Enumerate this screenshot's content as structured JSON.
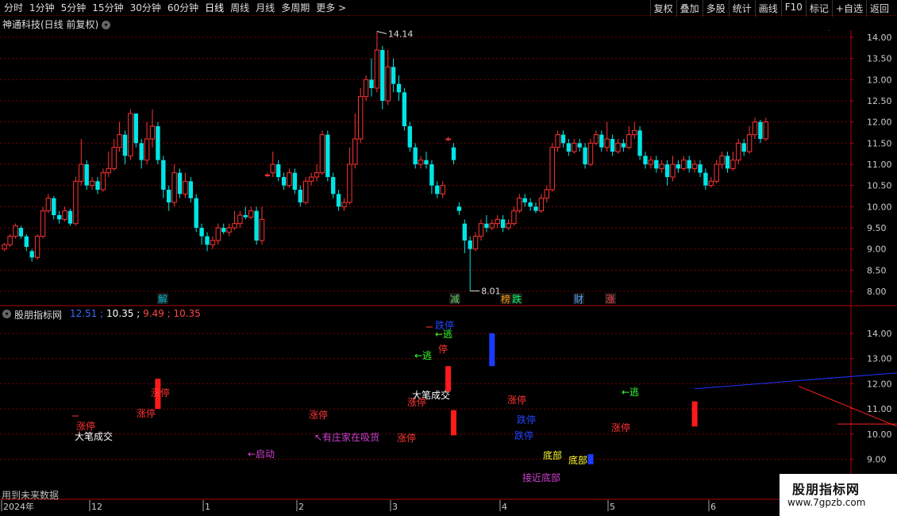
{
  "toolbar": {
    "periods": [
      "分时",
      "1分钟",
      "5分钟",
      "15分钟",
      "30分钟",
      "60分钟",
      "日线",
      "周线",
      "月线",
      "多周期",
      "更多 >"
    ],
    "active_period": "日线",
    "right_buttons": [
      "复权",
      "叠加",
      "多股",
      "统计",
      "画线",
      "F10",
      "标记",
      "+自选",
      "返回"
    ]
  },
  "main_chart": {
    "title": "神通科技(日线 前复权)",
    "high_label": "14.14",
    "low_label": "8.01",
    "y_ticks": [
      "14.00",
      "13.50",
      "13.00",
      "12.50",
      "12.00",
      "11.50",
      "11.00",
      "10.50",
      "10.00",
      "9.50",
      "9.00",
      "8.50",
      "8.00"
    ],
    "events": [
      {
        "text": "解",
        "color": "#00bcd4"
      },
      {
        "text": "减",
        "color": "#6ad06a"
      },
      {
        "text": "榜",
        "color": "#ff9900"
      },
      {
        "text": "跌",
        "color": "#00ff66"
      },
      {
        "text": "财",
        "color": "#4fa3ff"
      },
      {
        "text": "涨",
        "color": "#ff4444"
      }
    ]
  },
  "indicator": {
    "name": "股朋指标网",
    "values": [
      "12.51",
      "10.35",
      "9.49",
      "10.35"
    ],
    "value_colors": [
      "#3b6bff",
      "#ffffff",
      "#ff4444",
      "#ff4444"
    ],
    "y_ticks": [
      "14.00",
      "13.00",
      "12.00",
      "11.00",
      "10.00",
      "9.00"
    ],
    "labels": {
      "zt1": "涨停",
      "dbcj1": "大笔成交",
      "zt2": "涨停",
      "zt3": "涨停",
      "qd": "←启动",
      "zt4": "涨停",
      "zj": "↖有庄家在吸货",
      "zt5": "涨停",
      "dbcj2": "大笔成交",
      "zt6": "涨停",
      "dt1": "跌停",
      "tao1": "←逃",
      "tao2": "←逃",
      "ting": "停",
      "zt7": "涨停",
      "dt2": "跌停",
      "dt3": "跌停",
      "db1": "底部",
      "db2": "底部",
      "jjdb": "接近底部",
      "tao3": "←逃",
      "zt8": "涨停"
    }
  },
  "future_note": "用到未来数据",
  "xaxis": {
    "labels": [
      "2024年",
      "12",
      "1",
      "2",
      "3",
      "4",
      "5",
      "6"
    ]
  },
  "watermark": {
    "title": "股朋指标网",
    "url": "www.7gpzb.com"
  },
  "colors": {
    "up": "#ff3333",
    "down": "#00e5e5",
    "grid": "#7a0000",
    "axis": "#b00000"
  },
  "chart_data": {
    "type": "candlestick",
    "candles": [
      [
        9.0,
        9.1,
        8.95,
        9.15
      ],
      [
        9.1,
        9.3,
        9.05,
        9.35
      ],
      [
        9.3,
        9.55,
        9.25,
        9.6
      ],
      [
        9.5,
        9.3,
        9.25,
        9.55
      ],
      [
        9.3,
        9.05,
        8.95,
        9.35
      ],
      [
        8.95,
        8.8,
        8.7,
        9.0
      ],
      [
        8.8,
        9.3,
        8.75,
        9.35
      ],
      [
        9.3,
        9.9,
        9.25,
        10.0
      ],
      [
        9.9,
        10.2,
        9.85,
        10.3
      ],
      [
        10.2,
        9.8,
        9.7,
        10.25
      ],
      [
        9.8,
        9.7,
        9.6,
        9.9
      ],
      [
        9.7,
        9.9,
        9.65,
        10.0
      ],
      [
        9.9,
        9.6,
        9.55,
        9.95
      ],
      [
        9.6,
        10.6,
        9.55,
        10.7
      ],
      [
        10.6,
        11.0,
        10.5,
        11.6
      ],
      [
        11.0,
        10.5,
        10.4,
        11.1
      ],
      [
        10.5,
        10.6,
        10.4,
        10.7
      ],
      [
        10.6,
        10.4,
        10.3,
        10.7
      ],
      [
        10.4,
        10.8,
        10.35,
        10.9
      ],
      [
        10.8,
        10.9,
        10.7,
        11.3
      ],
      [
        10.9,
        11.4,
        10.85,
        11.6
      ],
      [
        11.4,
        11.7,
        11.3,
        12.0
      ],
      [
        11.7,
        11.2,
        11.0,
        11.8
      ],
      [
        11.2,
        12.2,
        11.1,
        12.3
      ],
      [
        12.2,
        11.5,
        11.4,
        12.2
      ],
      [
        11.5,
        11.1,
        10.9,
        11.6
      ],
      [
        11.1,
        11.6,
        11.0,
        12.0
      ],
      [
        11.6,
        11.9,
        11.4,
        12.3
      ],
      [
        11.9,
        11.1,
        11.0,
        12.0
      ],
      [
        11.1,
        10.4,
        10.2,
        11.2
      ],
      [
        10.4,
        10.1,
        9.9,
        10.5
      ],
      [
        10.1,
        10.8,
        10.0,
        11.0
      ],
      [
        10.8,
        10.3,
        10.2,
        10.9
      ],
      [
        10.3,
        10.6,
        10.2,
        10.8
      ],
      [
        10.6,
        10.2,
        10.1,
        10.7
      ],
      [
        10.2,
        9.5,
        9.4,
        10.3
      ],
      [
        9.5,
        9.3,
        9.1,
        9.6
      ],
      [
        9.3,
        9.1,
        8.95,
        9.4
      ],
      [
        9.1,
        9.2,
        9.0,
        9.3
      ],
      [
        9.2,
        9.5,
        9.1,
        9.6
      ],
      [
        9.5,
        9.4,
        9.35,
        9.6
      ],
      [
        9.4,
        9.5,
        9.3,
        9.6
      ],
      [
        9.5,
        9.6,
        9.45,
        9.9
      ],
      [
        9.6,
        9.8,
        9.5,
        9.9
      ],
      [
        9.8,
        9.75,
        9.7,
        10.0
      ],
      [
        9.75,
        9.9,
        9.7,
        10.0
      ],
      [
        9.9,
        9.2,
        9.1,
        10.0
      ],
      [
        9.2,
        9.7,
        9.1,
        10.0
      ],
      [
        10.75,
        10.75,
        10.7,
        10.8
      ],
      [
        10.8,
        11.0,
        10.7,
        11.3
      ],
      [
        11.0,
        10.7,
        10.6,
        11.1
      ],
      [
        10.7,
        10.5,
        10.4,
        10.8
      ],
      [
        10.5,
        10.8,
        10.45,
        10.9
      ],
      [
        10.8,
        10.4,
        10.3,
        10.9
      ],
      [
        10.4,
        10.1,
        10.0,
        10.5
      ],
      [
        10.1,
        10.6,
        10.05,
        10.7
      ],
      [
        10.6,
        10.7,
        10.5,
        10.8
      ],
      [
        10.7,
        10.8,
        10.6,
        11.0
      ],
      [
        10.8,
        11.7,
        10.75,
        11.8
      ],
      [
        11.7,
        10.7,
        10.6,
        11.8
      ],
      [
        10.7,
        10.3,
        10.2,
        10.8
      ],
      [
        10.3,
        10.0,
        9.9,
        10.4
      ],
      [
        10.0,
        10.1,
        9.9,
        10.2
      ],
      [
        10.1,
        11.0,
        10.05,
        11.4
      ],
      [
        11.0,
        11.6,
        10.9,
        12.2
      ],
      [
        11.6,
        12.6,
        11.5,
        12.8
      ],
      [
        12.6,
        13.0,
        12.5,
        13.1
      ],
      [
        13.0,
        12.8,
        12.6,
        13.5
      ],
      [
        12.8,
        13.7,
        12.7,
        14.14
      ],
      [
        13.7,
        12.5,
        12.3,
        13.8
      ],
      [
        12.5,
        13.3,
        12.4,
        13.7
      ],
      [
        13.3,
        12.9,
        12.7,
        13.5
      ],
      [
        12.9,
        12.7,
        12.5,
        13.1
      ],
      [
        12.7,
        11.9,
        11.8,
        12.8
      ],
      [
        11.9,
        11.4,
        11.3,
        12.0
      ],
      [
        11.4,
        11.0,
        10.9,
        11.5
      ],
      [
        11.0,
        11.1,
        10.9,
        11.2
      ],
      [
        11.1,
        11.0,
        10.9,
        11.3
      ],
      [
        11.0,
        10.5,
        10.3,
        11.1
      ],
      [
        10.5,
        10.3,
        10.2,
        10.6
      ],
      [
        10.3,
        10.5,
        10.2,
        10.6
      ],
      [
        11.6,
        11.6,
        11.55,
        11.65
      ],
      [
        11.4,
        11.1,
        11.0,
        11.5
      ],
      [
        10.0,
        9.9,
        9.8,
        10.1
      ],
      [
        9.6,
        9.2,
        8.9,
        9.7
      ],
      [
        9.2,
        9.0,
        8.01,
        9.3
      ],
      [
        9.0,
        9.3,
        8.95,
        9.4
      ],
      [
        9.3,
        9.6,
        9.2,
        9.7
      ],
      [
        9.6,
        9.5,
        9.4,
        9.8
      ],
      [
        9.5,
        9.6,
        9.45,
        9.7
      ],
      [
        9.6,
        9.7,
        9.5,
        9.8
      ],
      [
        9.7,
        9.5,
        9.4,
        9.8
      ],
      [
        9.5,
        9.6,
        9.45,
        9.7
      ],
      [
        9.6,
        9.9,
        9.55,
        10.0
      ],
      [
        9.9,
        10.2,
        9.85,
        10.3
      ],
      [
        10.2,
        10.1,
        10.0,
        10.3
      ],
      [
        10.1,
        10.0,
        9.9,
        10.2
      ],
      [
        10.0,
        9.9,
        9.85,
        10.1
      ],
      [
        9.9,
        10.2,
        9.85,
        10.3
      ],
      [
        10.2,
        10.4,
        10.1,
        10.5
      ],
      [
        10.4,
        11.4,
        10.35,
        11.5
      ],
      [
        11.4,
        11.7,
        11.3,
        11.8
      ],
      [
        11.7,
        11.5,
        11.4,
        11.8
      ],
      [
        11.5,
        11.3,
        11.2,
        11.6
      ],
      [
        11.3,
        11.5,
        11.25,
        11.6
      ],
      [
        11.5,
        11.4,
        11.3,
        11.6
      ],
      [
        11.4,
        11.0,
        10.9,
        11.5
      ],
      [
        11.0,
        11.5,
        10.95,
        11.6
      ],
      [
        11.5,
        11.7,
        11.45,
        11.8
      ],
      [
        11.7,
        11.4,
        11.3,
        11.8
      ],
      [
        11.4,
        11.6,
        11.3,
        12.0
      ],
      [
        11.6,
        11.3,
        11.2,
        11.7
      ],
      [
        11.3,
        11.5,
        11.25,
        11.6
      ],
      [
        11.5,
        11.4,
        11.3,
        11.6
      ],
      [
        11.4,
        11.7,
        11.35,
        11.9
      ],
      [
        11.7,
        11.8,
        11.6,
        12.0
      ],
      [
        11.8,
        11.2,
        11.1,
        11.9
      ],
      [
        11.2,
        11.0,
        10.9,
        11.3
      ],
      [
        11.0,
        11.1,
        10.9,
        11.2
      ],
      [
        11.1,
        10.9,
        10.8,
        11.2
      ],
      [
        10.9,
        11.0,
        10.8,
        11.1
      ],
      [
        11.0,
        10.7,
        10.5,
        11.1
      ],
      [
        10.7,
        11.0,
        10.6,
        11.2
      ],
      [
        11.0,
        10.9,
        10.8,
        11.1
      ],
      [
        10.9,
        11.1,
        10.85,
        11.2
      ],
      [
        11.1,
        10.9,
        10.8,
        11.2
      ],
      [
        10.9,
        11.0,
        10.8,
        11.1
      ],
      [
        11.0,
        10.8,
        10.7,
        11.1
      ],
      [
        10.8,
        10.5,
        10.4,
        10.9
      ],
      [
        10.5,
        10.6,
        10.45,
        10.7
      ],
      [
        10.6,
        11.0,
        10.55,
        11.1
      ],
      [
        11.0,
        11.2,
        10.9,
        11.3
      ],
      [
        11.2,
        10.9,
        10.8,
        11.3
      ],
      [
        10.9,
        11.1,
        10.85,
        11.3
      ],
      [
        11.1,
        11.5,
        11.0,
        11.6
      ],
      [
        11.5,
        11.3,
        11.2,
        11.6
      ],
      [
        11.3,
        11.7,
        11.25,
        11.9
      ],
      [
        11.7,
        12.0,
        11.6,
        12.1
      ],
      [
        12.0,
        11.6,
        11.5,
        12.05
      ],
      [
        11.6,
        12.0,
        11.55,
        12.1
      ]
    ],
    "indicator_segments": [
      {
        "idx": 28,
        "from": 11.0,
        "to": 12.2,
        "color": "red"
      },
      {
        "idx": 81,
        "from": 11.7,
        "to": 12.7,
        "color": "red"
      },
      {
        "idx": 82,
        "from": 9.95,
        "to": 10.95,
        "color": "red"
      },
      {
        "idx": 89,
        "from": 12.7,
        "to": 14.0,
        "color": "blue"
      },
      {
        "idx": 107,
        "from": 8.8,
        "to": 9.2,
        "color": "blue"
      },
      {
        "idx": 126,
        "from": 10.3,
        "to": 11.3,
        "color": "red"
      }
    ],
    "lines": [
      {
        "from": [
          126,
          11.8
        ],
        "to": [
          167,
          12.5
        ],
        "color": "blue"
      },
      {
        "from": [
          145,
          11.9
        ],
        "to": [
          172,
          9.5
        ],
        "color": "red"
      },
      {
        "from": [
          152,
          10.4
        ],
        "to": [
          172,
          10.4
        ],
        "color": "red"
      }
    ]
  }
}
